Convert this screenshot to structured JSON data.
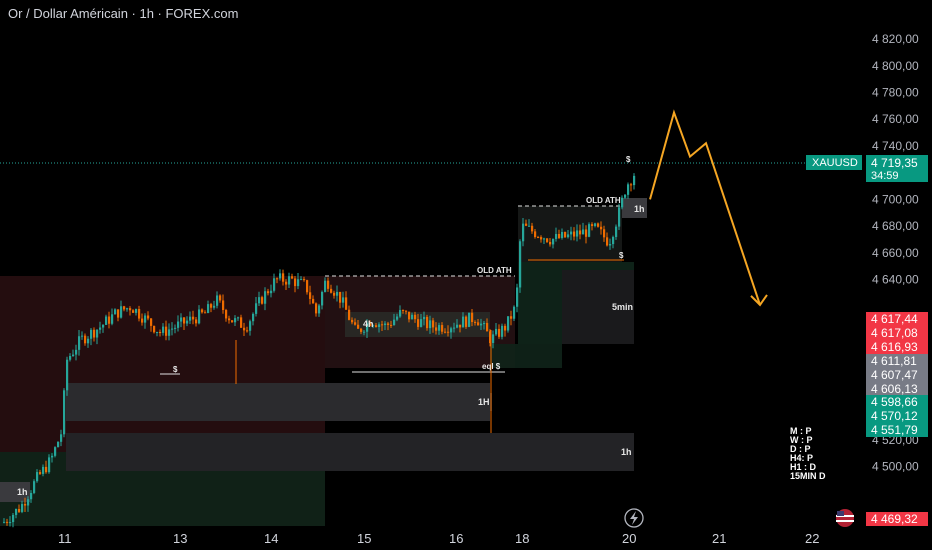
{
  "header": {
    "title": "Or / Dollar Américain · 1h · FOREX.com"
  },
  "chart_data": {
    "type": "candlestick",
    "symbol": "XAUUSD",
    "timeframe": "1h",
    "title": "Or / Dollar Américain · 1h · FOREX.com",
    "ylim": [
      4454,
      4832
    ],
    "y_ticks": [
      "4 820,00",
      "4 800,00",
      "4 780,00",
      "4 760,00",
      "4 740,00",
      "4 700,00",
      "4 680,00",
      "4 660,00",
      "4 640,00",
      "4 520,00",
      "4 500,00"
    ],
    "x_ticks": [
      "11",
      "13",
      "14",
      "15",
      "16",
      "18",
      "20",
      "21",
      "22"
    ],
    "last_price": {
      "symbol": "XAUUSD",
      "price": "4 719,35",
      "countdown": "34:59"
    },
    "price_badges": [
      {
        "label": "4 617,44",
        "color": "#f23645"
      },
      {
        "label": "4 617,08",
        "color": "#f23645"
      },
      {
        "label": "4 616,93",
        "color": "#f23645"
      },
      {
        "label": "4 611,81",
        "color": "#787b86"
      },
      {
        "label": "4 607,47",
        "color": "#787b86"
      },
      {
        "label": "4 606,13",
        "color": "#787b86"
      },
      {
        "label": "4 598,66",
        "color": "#089981"
      },
      {
        "label": "4 570,12",
        "color": "#089981"
      },
      {
        "label": "4 551,79",
        "color": "#089981"
      },
      {
        "label": "4 469,32",
        "color": "#f23645"
      }
    ],
    "annotations": {
      "old_ath_1": "OLD ATH",
      "old_ath_2": "OLD ATH",
      "eql": "eql $",
      "dollar": "$",
      "zone_4h": "4h",
      "zone_5min": "5min",
      "zone_1H": "1H",
      "zone_1h_a": "1h",
      "zone_1h_b": "1h",
      "zone_1h_c": "1h"
    },
    "bias": [
      "M : P",
      "W : P",
      "D : P",
      "H4: P",
      "H1 : D",
      "15MIN D"
    ],
    "projection": [
      [
        4700,
        "now"
      ],
      [
        4765,
        "peak1"
      ],
      [
        4732,
        "dip"
      ],
      [
        4742,
        "peak2"
      ],
      [
        4621,
        "target"
      ]
    ],
    "colors": {
      "up": "#26a69a",
      "down": "#ef6c00",
      "projection": "#f5a623",
      "background": "#000000"
    }
  }
}
